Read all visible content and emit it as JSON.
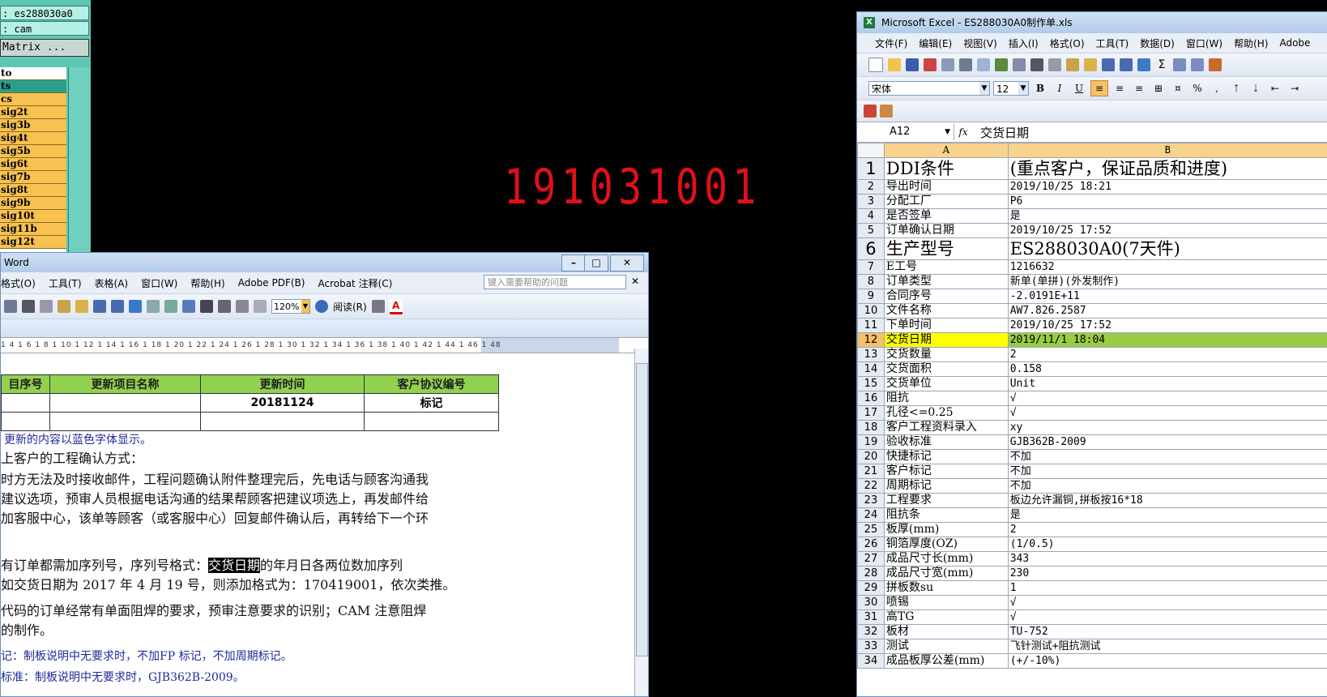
{
  "cam": {
    "job_label": ": es288030a0",
    "step_label": ": cam",
    "matrix_button": "Matrix ...",
    "layers": [
      "to",
      "ts",
      "cs",
      "sig2t",
      "sig3b",
      "sig4t",
      "sig5b",
      "sig6t",
      "sig7b",
      "sig8t",
      "sig9b",
      "sig10t",
      "sig11b",
      "sig12t"
    ]
  },
  "overlay_number": "191031001",
  "excel": {
    "title": "Microsoft Excel - ES288030A0制作单.xls",
    "menu": [
      "文件(F)",
      "编辑(E)",
      "视图(V)",
      "插入(I)",
      "格式(O)",
      "工具(T)",
      "数据(D)",
      "窗口(W)",
      "帮助(H)",
      "Adobe"
    ],
    "font_name": "宋体",
    "font_size": "12",
    "name_box": "A12",
    "formula_value": "交货日期",
    "col_a": "A",
    "col_b": "B",
    "selected_row": 12,
    "rows": [
      {
        "n": "1",
        "a": "DDI条件",
        "b": "(重点客户，保证品质和进度)"
      },
      {
        "n": "2",
        "a": "导出时间",
        "b": "2019/10/25 18:21"
      },
      {
        "n": "3",
        "a": "分配工厂",
        "b": "P6"
      },
      {
        "n": "4",
        "a": "是否签单",
        "b": "是"
      },
      {
        "n": "5",
        "a": "订单确认日期",
        "b": "2019/10/25 17:52"
      },
      {
        "n": "6",
        "a": "生产型号",
        "b": "ES288030A0(7天件)"
      },
      {
        "n": "7",
        "a": "E工号",
        "b": "1216632"
      },
      {
        "n": "8",
        "a": "订单类型",
        "b": "新单(单拼)(外发制作)"
      },
      {
        "n": "9",
        "a": "合同序号",
        "b": "-2.0191E+11"
      },
      {
        "n": "10",
        "a": "文件名称",
        "b": "AW7.826.2587"
      },
      {
        "n": "11",
        "a": "下单时间",
        "b": "2019/10/25 17:52"
      },
      {
        "n": "12",
        "a": "交货日期",
        "b": "2019/11/1 18:04"
      },
      {
        "n": "13",
        "a": "交货数量",
        "b": "2"
      },
      {
        "n": "14",
        "a": "交货面积",
        "b": "0.158"
      },
      {
        "n": "15",
        "a": "交货单位",
        "b": "Unit"
      },
      {
        "n": "16",
        "a": "阻抗",
        "b": "√"
      },
      {
        "n": "17",
        "a": "孔径<=0.25",
        "b": "√"
      },
      {
        "n": "18",
        "a": "客户工程资料录入",
        "b": "xy"
      },
      {
        "n": "19",
        "a": "验收标准",
        "b": "GJB362B-2009"
      },
      {
        "n": "20",
        "a": "快捷标记",
        "b": "不加"
      },
      {
        "n": "21",
        "a": "客户标记",
        "b": "不加"
      },
      {
        "n": "22",
        "a": "周期标记",
        "b": "不加"
      },
      {
        "n": "23",
        "a": "工程要求",
        "b": "板边允许漏铜,拼板按16*18"
      },
      {
        "n": "24",
        "a": "阻抗条",
        "b": "是"
      },
      {
        "n": "25",
        "a": "板厚(mm)",
        "b": "2"
      },
      {
        "n": "26",
        "a": "铜箔厚度(OZ)",
        "b": "(1/0.5)"
      },
      {
        "n": "27",
        "a": "成品尺寸长(mm)",
        "b": "343"
      },
      {
        "n": "28",
        "a": "成品尺寸宽(mm)",
        "b": "230"
      },
      {
        "n": "29",
        "a": "拼板数su",
        "b": "1"
      },
      {
        "n": "30",
        "a": "喷锡",
        "b": "√"
      },
      {
        "n": "31",
        "a": "高TG",
        "b": "√"
      },
      {
        "n": "32",
        "a": "板材",
        "b": "TU-752"
      },
      {
        "n": "33",
        "a": "测试",
        "b": "飞针测试+阻抗测试"
      },
      {
        "n": "34",
        "a": "成品板厚公差(mm)",
        "b": "(+/-10%)"
      }
    ]
  },
  "word": {
    "title": "Word",
    "menu": [
      "格式(O)",
      "工具(T)",
      "表格(A)",
      "窗口(W)",
      "帮助(H)",
      "Adobe PDF(B)",
      "Acrobat 注释(C)"
    ],
    "help_placeholder": "键入需要帮助的问题",
    "zoom": "120%",
    "read_button": "阅读(R)",
    "ruler": "1 4 1 6 1 8 1 10 1 12 1 14 1 16 1 18 1 20 1 22 1 24 1 26 1 28 1 30 1 32 1 34 1 36 1 38 1 40 1 42 1 44 1 46 1 48",
    "table_headers": [
      "目序号",
      "更新项目名称",
      "更新时间",
      "客户协议编号"
    ],
    "table_row1": [
      "",
      "",
      "20181124",
      "标记"
    ],
    "para1": "更新的内容以蓝色字体显示。",
    "para2": "上客户的工程确认方式：",
    "para3a": "时方无法及时接收邮件，工程问题确认附件整理完后，先电话与顾客沟通我",
    "para3b": "建议选项，预审人员根据电话沟通的结果帮顾客把建议项选上，再发邮件给",
    "para3c": "加客服中心，该单等顾客（或客服中心）回复邮件确认后，再转给下一个环",
    "para4_pre": "有订单都需加序列号，序列号格式：",
    "para4_hl": "交货日期",
    "para4_post": "的年月日各两位数加序列",
    "para4b": "如交货日期为 2017 年 4 月 19 号，则添加格式为：170419001，依次类推。",
    "para5a": "代码的订单经常有单面阻焊的要求，预审注意要求的识别；CAM 注意阻焊",
    "para5b": "的制作。",
    "para6": "记：制板说明中无要求时，不加FP 标记，不加周期标记。",
    "para7": "标准：制板说明中无要求时，GJB362B-2009。"
  }
}
